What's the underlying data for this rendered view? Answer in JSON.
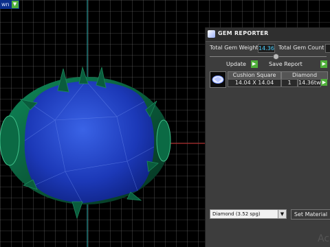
{
  "viewport": {
    "dropdown_label": "wn"
  },
  "panel": {
    "title": "GEM REPORTER",
    "total_weight_label": "Total Gem Weight",
    "total_weight_value": "14.36",
    "total_count_label": "Total Gem Count",
    "update_label": "Update",
    "save_report_label": "Save Report",
    "table": {
      "headers": [
        "Cushion Square",
        "Diamond"
      ],
      "row": {
        "size": "14.04 X 14.04",
        "count": "1",
        "weight": "14.36tw"
      }
    },
    "material_select": "Diamond     (3.52 spg)",
    "set_material_label": "Set Material"
  },
  "overlay": {
    "activate_text": "Ac"
  },
  "colors": {
    "gem": "#1f3fbf",
    "setting": "#0e6b47",
    "grid": "#8a8a8a",
    "accent_button": "#4fb03a",
    "value_text": "#4ad0ff"
  }
}
